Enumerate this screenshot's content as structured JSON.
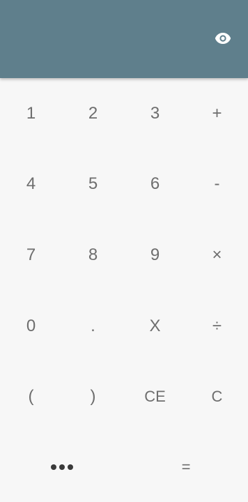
{
  "header": {
    "visibility_icon": "eye-icon",
    "color": "#5f7f8c"
  },
  "keypad": {
    "rows": [
      [
        "1",
        "2",
        "3",
        "+"
      ],
      [
        "4",
        "5",
        "6",
        "-"
      ],
      [
        "7",
        "8",
        "9",
        "×"
      ],
      [
        "0",
        ".",
        "X",
        "÷"
      ],
      [
        "(",
        ")",
        "CE",
        "C"
      ]
    ]
  },
  "bottom": {
    "more_icon": "more-horizontal-icon",
    "equals_label": "="
  }
}
